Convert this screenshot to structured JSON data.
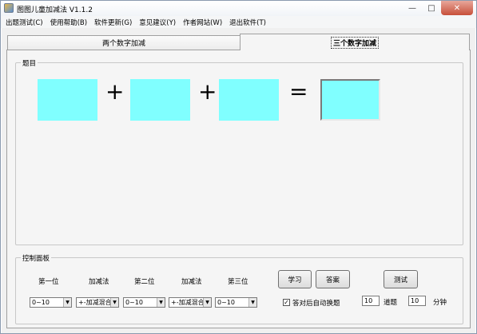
{
  "window": {
    "title": "图图儿童加减法 V1.1.2",
    "min": "—",
    "max": "□",
    "close": "✕"
  },
  "menu": [
    "出题测试(C)",
    "使用帮助(B)",
    "软件更新(G)",
    "意见建议(Y)",
    "作者网站(W)",
    "退出软件(T)"
  ],
  "tabs": [
    "两个数字加减",
    "三个数字加减"
  ],
  "question": {
    "legend": "题目",
    "operators": [
      "+",
      "+",
      "="
    ],
    "box_color": "#80ffff"
  },
  "control": {
    "legend": "控制面板",
    "labels": [
      "第一位",
      "加减法",
      "第二位",
      "加减法",
      "第三位"
    ],
    "combos": [
      "0~10",
      "+-加减混合",
      "0~10",
      "+-加减混合",
      "0~10"
    ],
    "buttons": {
      "learn": "学习",
      "answer": "答案",
      "test": "测试"
    },
    "auto_next_label": "答对后自动换题",
    "auto_next_checked": "✓",
    "count_value": "10",
    "count_unit": "道题",
    "time_value": "10",
    "time_unit": "分钟"
  }
}
